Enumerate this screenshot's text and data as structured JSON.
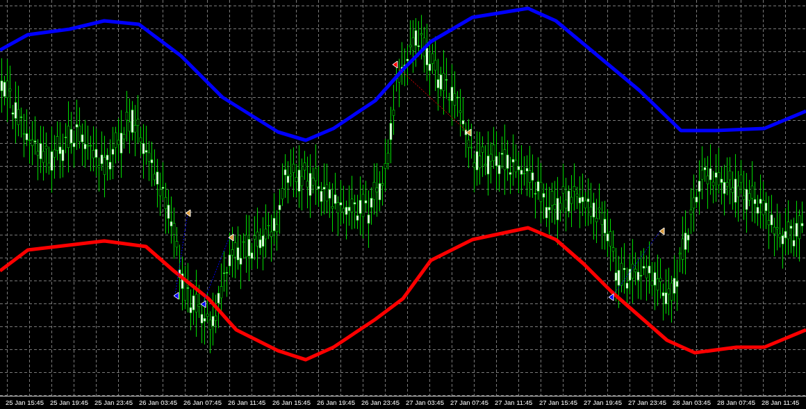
{
  "x_axis": {
    "labels": [
      "25 Jan 15:45",
      "25 Jan 19:45",
      "25 Jan 23:45",
      "26 Jan 03:45",
      "26 Jan 07:45",
      "26 Jan 11:45",
      "26 Jan 15:45",
      "26 Jan 19:45",
      "26 Jan 23:45",
      "27 Jan 03:45",
      "27 Jan 07:45",
      "27 Jan 11:45",
      "27 Jan 15:45",
      "27 Jan 19:45",
      "27 Jan 23:45",
      "28 Jan 03:45",
      "28 Jan 07:45",
      "28 Jan 11:45"
    ]
  }
}
